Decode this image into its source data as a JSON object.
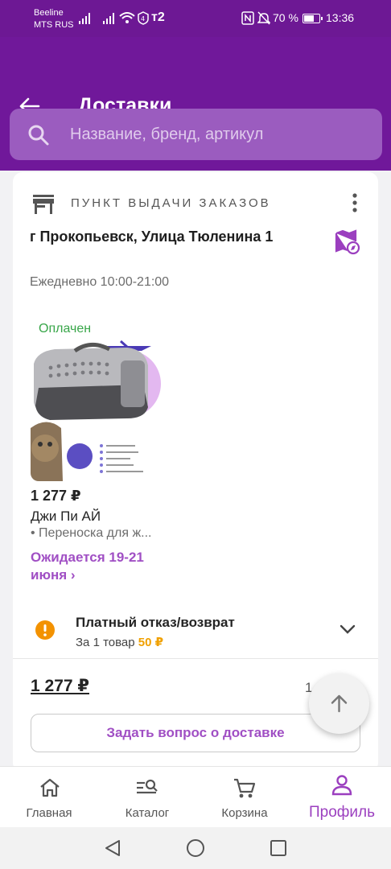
{
  "status_bar": {
    "carrier_1": "Beeline",
    "carrier_2": "MTS RUS",
    "network": "ᴛ2",
    "battery": "70 %",
    "battery_level": 0.7,
    "time": "13:36"
  },
  "header": {
    "title": "Доставки",
    "search_placeholder": "Название, бренд, артикул"
  },
  "delivery": {
    "pickup_label": "ПУНКТ ВЫДАЧИ ЗАКАЗОВ",
    "address": "г Прокопьевск, Улица Тюленина 1",
    "hours": "Ежедневно 10:00-21:00",
    "item": {
      "status": "Оплачен",
      "price": "1 277 ₽",
      "brand": "Джи Пи АЙ",
      "name": "• Переноска для ж...",
      "expected": "Ожидается 19-21 июня ›"
    },
    "refusal": {
      "title": "Платный отказ/возврат",
      "subtitle": "За 1 товар",
      "fee": "50 ₽"
    },
    "total": "1 277 ₽",
    "count_partial": "1",
    "ask_button": "Задать вопрос о доставке"
  },
  "bottom_nav": {
    "items": [
      {
        "label": "Главная",
        "icon": "home-icon"
      },
      {
        "label": "Каталог",
        "icon": "catalog-search-icon"
      },
      {
        "label": "Корзина",
        "icon": "cart-icon"
      },
      {
        "label": "Профиль",
        "icon": "profile-icon",
        "active": true
      }
    ]
  },
  "colors": {
    "brand_purple": "#70189a",
    "accent_purple": "#a04fc4",
    "paid_green": "#38a649",
    "warning_orange": "#f39200"
  }
}
